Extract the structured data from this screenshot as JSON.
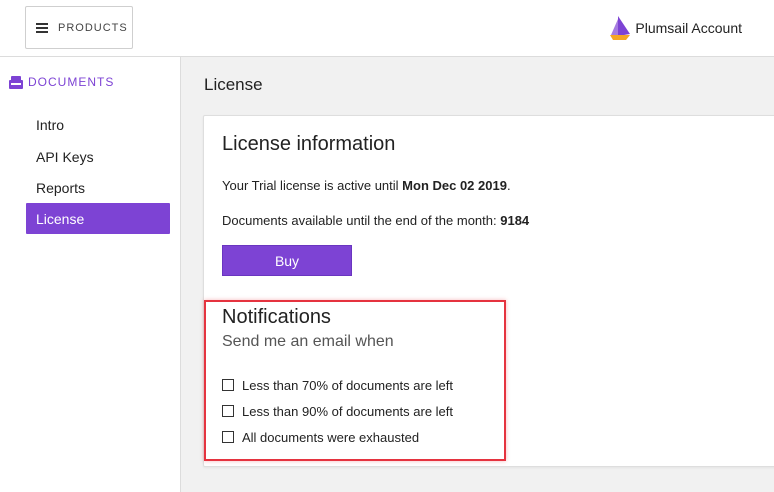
{
  "topbar": {
    "products_label": "PRODUCTS",
    "account_label": "Plumsail Account"
  },
  "sidebar": {
    "section_title": "DOCUMENTS",
    "items": [
      {
        "label": "Intro",
        "active": false
      },
      {
        "label": "API Keys",
        "active": false
      },
      {
        "label": "Reports",
        "active": false
      },
      {
        "label": "License",
        "active": true
      }
    ]
  },
  "main": {
    "page_title": "License",
    "card": {
      "title": "License information",
      "trial_prefix": "Your Trial license is active until ",
      "trial_date": "Mon Dec 02 2019",
      "trial_suffix": ".",
      "docs_prefix": "Documents available until the end of the month: ",
      "docs_count": "9184",
      "buy_label": "Buy"
    },
    "notifications": {
      "title": "Notifications",
      "subtitle": "Send me an email when",
      "options": [
        {
          "label": "Less than 70% of documents are left",
          "checked": false
        },
        {
          "label": "Less than 90% of documents are left",
          "checked": false
        },
        {
          "label": "All documents were exhausted",
          "checked": false
        }
      ]
    }
  },
  "colors": {
    "accent": "#7d43d4",
    "highlight": "#e5333f",
    "logo_orange": "#f5a623"
  }
}
